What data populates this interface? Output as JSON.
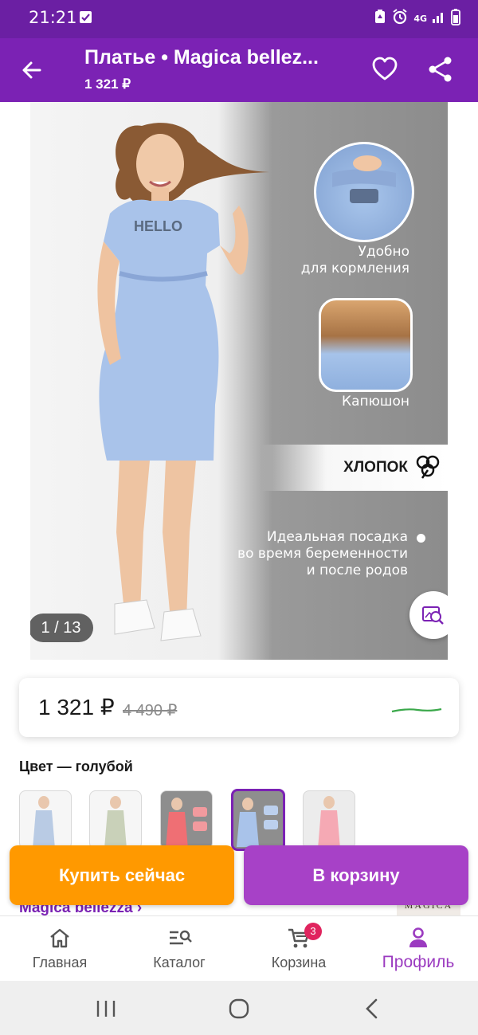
{
  "status_bar": {
    "time": "21:21",
    "network": "4G"
  },
  "header": {
    "title": "Платье • Magica bellez...",
    "price": "1 321 ₽"
  },
  "gallery": {
    "counter": "1 / 13",
    "feature_1": [
      "Удобно",
      "для кормления"
    ],
    "feature_2": "Капюшон",
    "cotton": "ХЛОПОК",
    "feature_3": [
      "Идеальная посадка",
      "во время беременности",
      "и после родов"
    ],
    "print_text": "HELLO"
  },
  "price_card": {
    "current": "1 321 ₽",
    "old": "4 490 ₽",
    "accent_line_color": "#3aa84a"
  },
  "color": {
    "label": "Цвет — голубой",
    "selected_index": 3,
    "count": 5
  },
  "actions": {
    "buy_now": "Купить сейчас",
    "add_to_cart": "В корзину"
  },
  "brand": {
    "link": "Magica bellezza ›",
    "logo_text": "MAGICA"
  },
  "bottom_nav": {
    "items": [
      {
        "label": "Главная",
        "icon": "home-icon"
      },
      {
        "label": "Каталог",
        "icon": "catalog-search-icon"
      },
      {
        "label": "Корзина",
        "icon": "cart-icon",
        "badge": "3"
      },
      {
        "label": "Профиль",
        "icon": "profile-icon",
        "active": true
      }
    ]
  },
  "colors": {
    "primary": "#7b22b4",
    "status_bar": "#6b1fa3",
    "buy_now": "#ff9900",
    "add_to_cart": "#a741c7",
    "badge": "#e0245e"
  }
}
